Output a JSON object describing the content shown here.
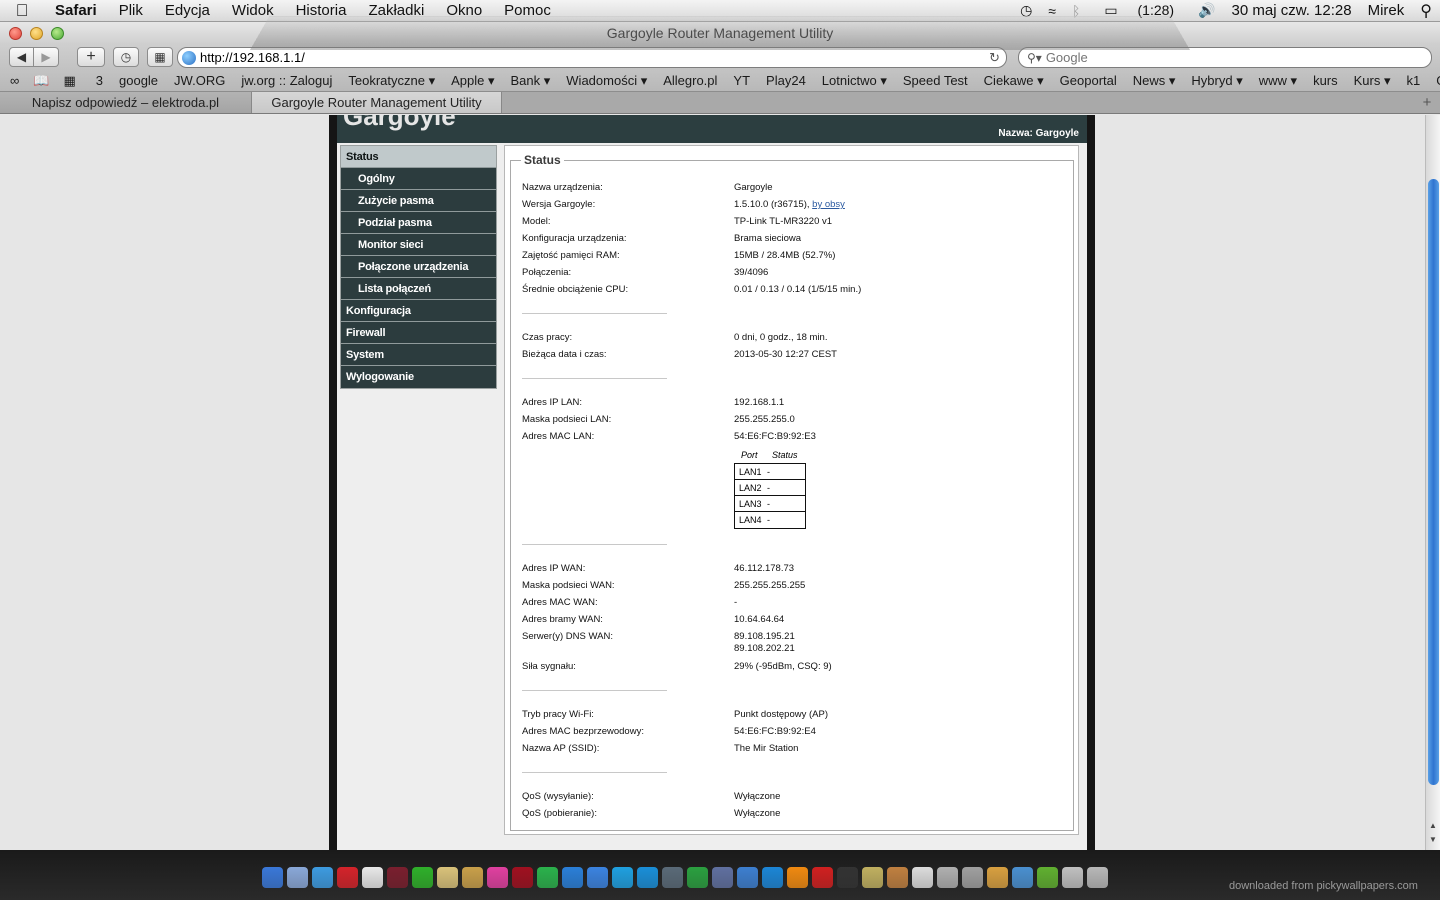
{
  "menubar": {
    "apple": "",
    "items": [
      "Safari",
      "Plik",
      "Edycja",
      "Widok",
      "Historia",
      "Zakładki",
      "Okno",
      "Pomoc"
    ],
    "battery": "(1:28)",
    "datetime": "30 maj czw.  12:28",
    "user": "Mirek"
  },
  "window": {
    "title": "Gargoyle Router Management Utility"
  },
  "toolbar": {
    "url": "http://192.168.1.1/",
    "search_placeholder": "Google"
  },
  "bookmarks": {
    "count": "3",
    "items": [
      "google",
      "JW.ORG",
      "jw.org :: Zaloguj",
      "Teokratyczne ▾",
      "Apple ▾",
      "Bank ▾",
      "Wiadomości ▾",
      "Allegro.pl",
      "YT",
      "Play24",
      "Lotnictwo ▾",
      "Speed Test",
      "Ciekawe ▾",
      "Geoportal",
      "News ▾",
      "Hybryd ▾",
      "www ▾",
      "kurs",
      "Kurs ▾",
      "k1",
      "Gmail"
    ],
    "more": "»"
  },
  "tabs": [
    {
      "label": "Napisz odpowiedź – elektroda.pl",
      "active": false
    },
    {
      "label": "Gargoyle Router Management Utility",
      "active": true
    }
  ],
  "router": {
    "logo": "Gargoyle",
    "device_name": "Nazwa: Gargoyle",
    "nav": [
      {
        "label": "Status",
        "level": 0,
        "selected": true
      },
      {
        "label": "Ogólny",
        "level": 1,
        "selected": true
      },
      {
        "label": "Zużycie pasma",
        "level": 1
      },
      {
        "label": "Podział pasma",
        "level": 1
      },
      {
        "label": "Monitor sieci",
        "level": 1
      },
      {
        "label": "Połączone urządzenia",
        "level": 1
      },
      {
        "label": "Lista połączeń",
        "level": 1
      },
      {
        "label": "Konfiguracja",
        "level": 0
      },
      {
        "label": "Firewall",
        "level": 0
      },
      {
        "label": "System",
        "level": 0
      },
      {
        "label": "Wylogowanie",
        "level": 0
      }
    ],
    "legend": "Status",
    "rows": [
      {
        "label": "Nazwa urządzenia:",
        "value": "Gargoyle"
      },
      {
        "label": "Wersja Gargoyle:",
        "value": "1.5.10.0 (r36715), ",
        "link": "by obsy"
      },
      {
        "label": "Model:",
        "value": "TP-Link TL-MR3220 v1"
      },
      {
        "label": "Konfiguracja urządzenia:",
        "value": "Brama sieciowa"
      },
      {
        "label": "Zajętość pamięci RAM:",
        "value": "15MB / 28.4MB (52.7%)"
      },
      {
        "label": "Połączenia:",
        "value": "39/4096"
      },
      {
        "label": "Średnie obciążenie CPU:",
        "value": "0.01 / 0.13 / 0.14  (1/5/15 min.)"
      },
      {
        "label": "Czas pracy:",
        "value": "0 dni, 0 godz., 18 min."
      },
      {
        "label": "Bieżąca data i czas:",
        "value": "2013-05-30 12:27 CEST"
      },
      {
        "label": "Adres IP LAN:",
        "value": "192.168.1.1"
      },
      {
        "label": "Maska podsieci LAN:",
        "value": "255.255.255.0"
      },
      {
        "label": "Adres MAC LAN:",
        "value": "54:E6:FC:B9:92:E3"
      },
      {
        "label": "Adres IP WAN:",
        "value": "46.112.178.73"
      },
      {
        "label": "Maska podsieci WAN:",
        "value": "255.255.255.255"
      },
      {
        "label": "Adres MAC WAN:",
        "value": "-"
      },
      {
        "label": "Adres bramy WAN:",
        "value": "10.64.64.64"
      },
      {
        "label": "Serwer(y) DNS WAN:",
        "value": "89.108.195.21",
        "value2": "89.108.202.21"
      },
      {
        "label": "Siła sygnału:",
        "value": "29% (-95dBm, CSQ: 9)"
      },
      {
        "label": "Tryb pracy Wi-Fi:",
        "value": "Punkt dostępowy (AP)"
      },
      {
        "label": "Adres MAC bezprzewodowy:",
        "value": "54:E6:FC:B9:92:E4"
      },
      {
        "label": "Nazwa AP (SSID):",
        "value": "The Mir Station"
      },
      {
        "label": "QoS (wysyłanie):",
        "value": "Wyłączone"
      },
      {
        "label": "QoS (pobieranie):",
        "value": "Wyłączone"
      }
    ],
    "lan_table": {
      "headers": [
        "Port",
        "Status"
      ],
      "rows": [
        [
          "LAN1",
          "-"
        ],
        [
          "LAN2",
          "-"
        ],
        [
          "LAN3",
          "-"
        ],
        [
          "LAN4",
          "-"
        ]
      ]
    }
  },
  "watermark": "downloaded from pickywallpapers.com"
}
